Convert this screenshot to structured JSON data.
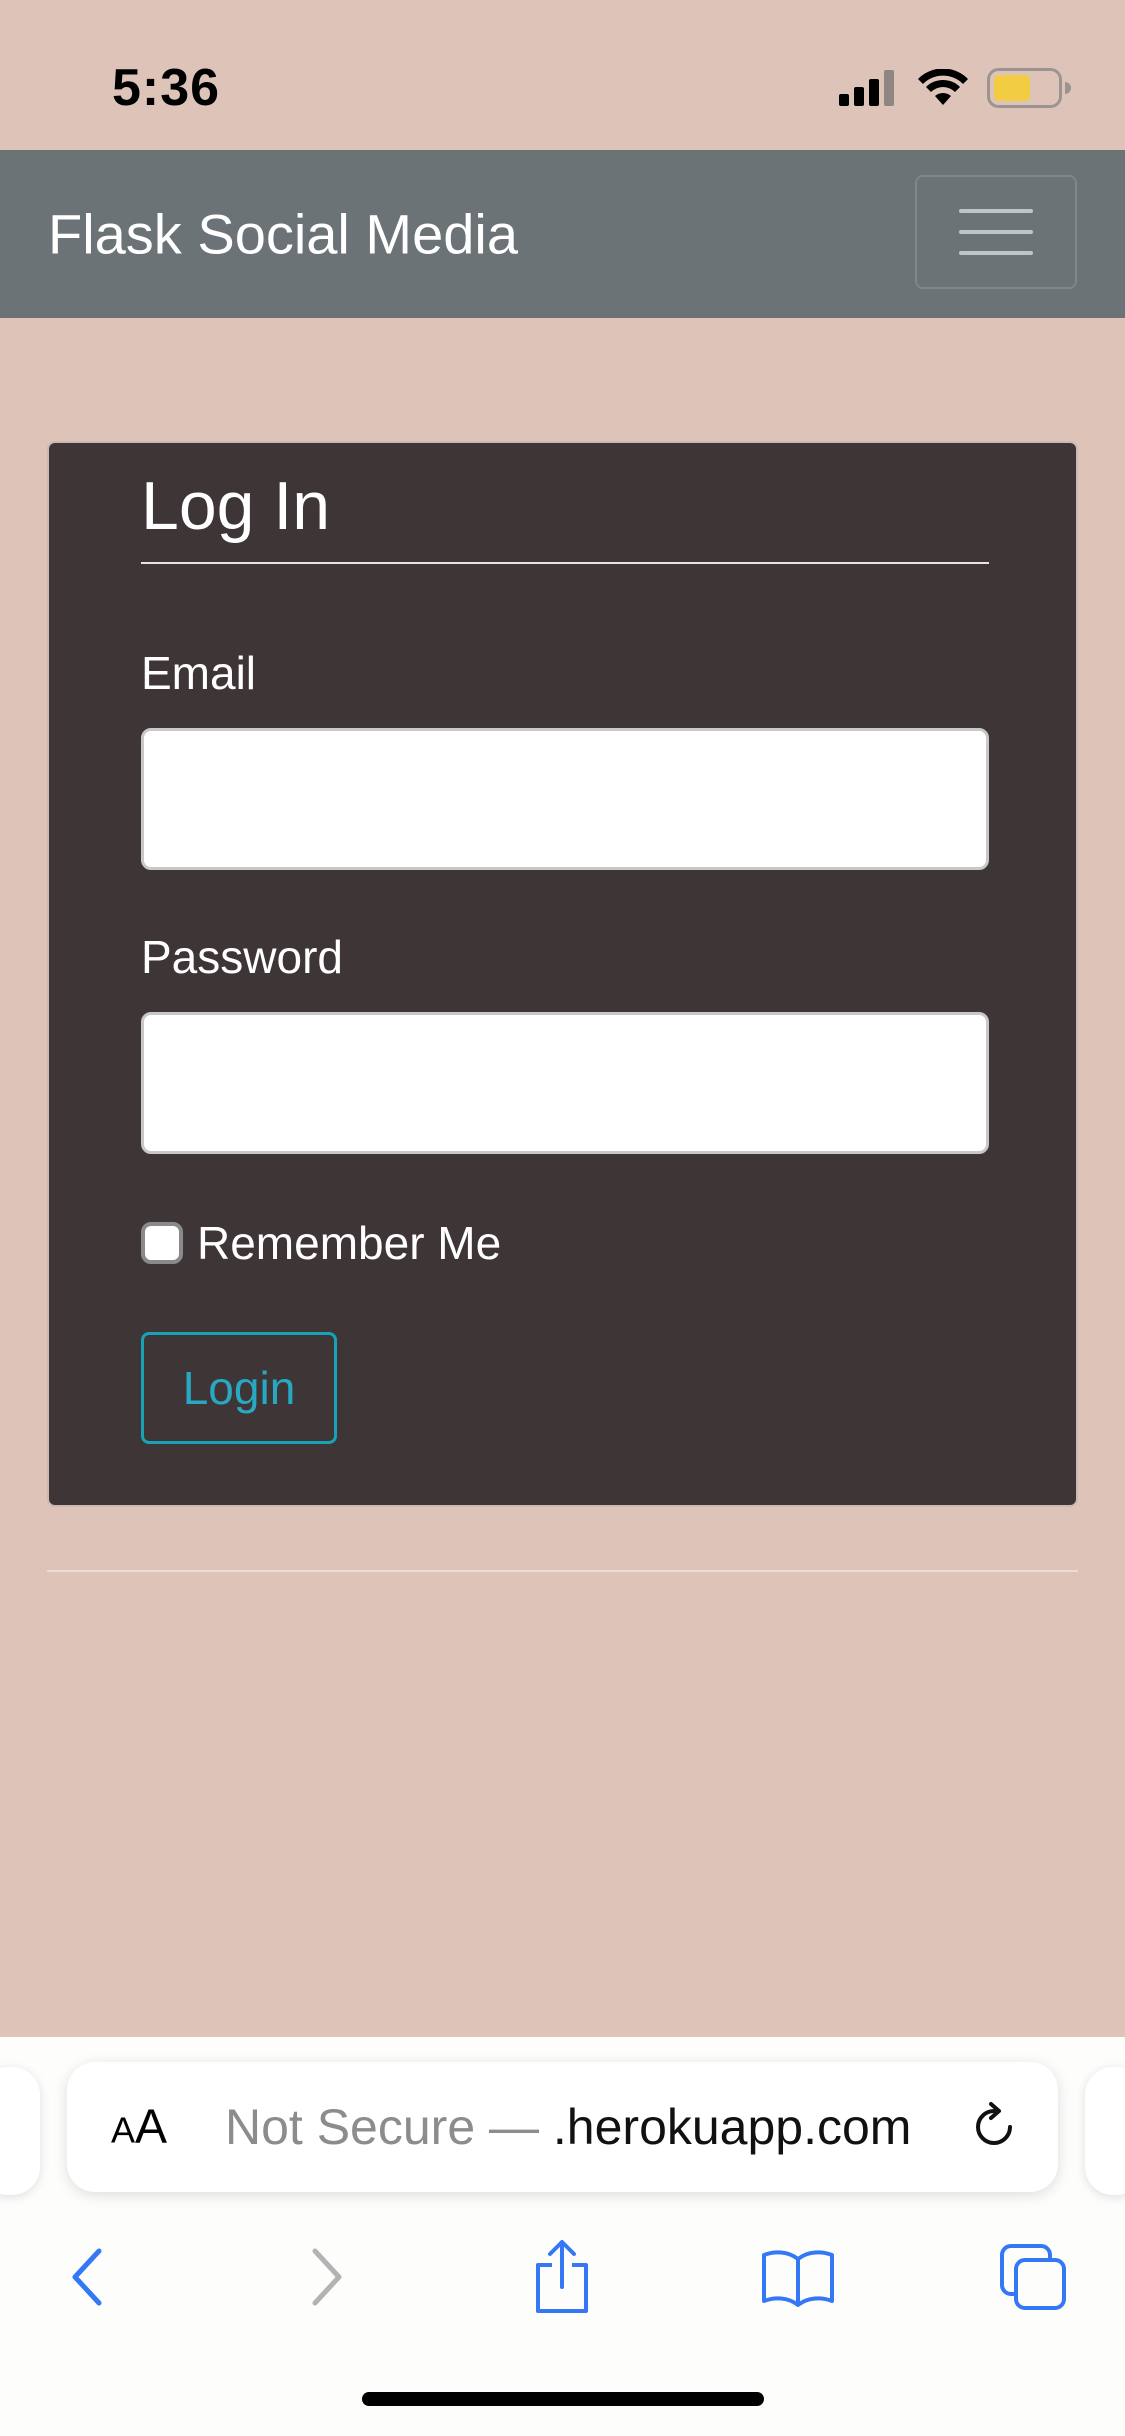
{
  "status_bar": {
    "time": "5:36"
  },
  "navbar": {
    "brand": "Flask Social Media"
  },
  "login_card": {
    "title": "Log In",
    "email_label": "Email",
    "email_value": "",
    "password_label": "Password",
    "password_value": "",
    "remember_label": "Remember Me",
    "remember_checked": false,
    "submit_label": "Login"
  },
  "browser": {
    "text_size_label_small": "A",
    "text_size_label_large": "A",
    "url_security": "Not Secure — ",
    "url_domain": ".herokuapp.com"
  },
  "colors": {
    "page_background": "#dec3b8",
    "navbar": "#6b7376",
    "card": "#3e3537",
    "accent_button": "#17a2b8",
    "safari_blue": "#3478f6"
  }
}
